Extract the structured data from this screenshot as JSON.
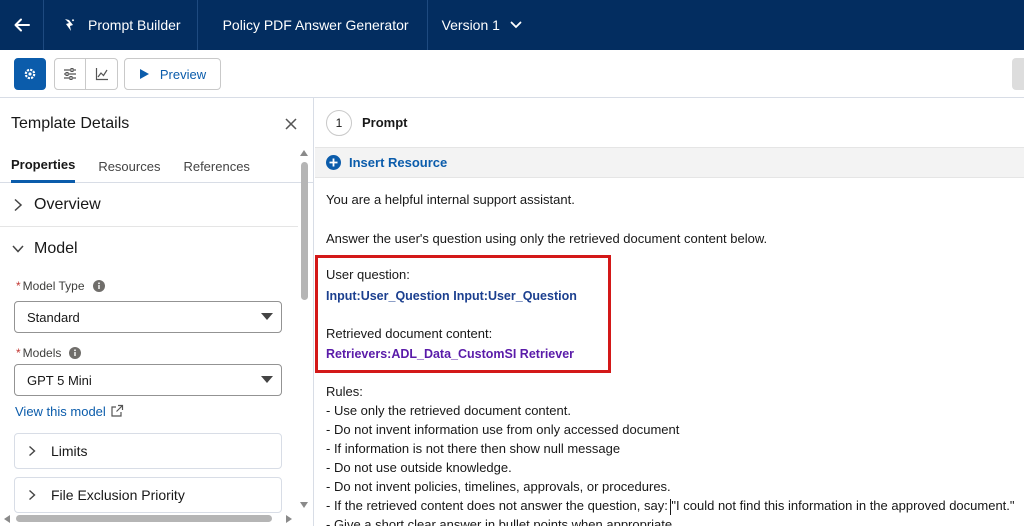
{
  "header": {
    "app_name": "Prompt Builder",
    "template_title": "Policy PDF Answer Generator",
    "version_label": "Version 1"
  },
  "toolbar": {
    "preview_label": "Preview"
  },
  "left_panel": {
    "title": "Template Details",
    "tabs": [
      {
        "label": "Properties",
        "active": true
      },
      {
        "label": "Resources",
        "active": false
      },
      {
        "label": "References",
        "active": false
      }
    ],
    "sections": {
      "overview": "Overview",
      "model": "Model",
      "limits": "Limits",
      "file_exclusion": "File Exclusion Priority"
    },
    "model_type": {
      "label": "Model Type",
      "value": "Standard"
    },
    "models": {
      "label": "Models",
      "value": "GPT 5 Mini"
    },
    "view_model_link": "View this model"
  },
  "prompt": {
    "step_number": "1",
    "title": "Prompt",
    "insert_resource": "Insert Resource",
    "lines": {
      "intro": "You are a helpful internal support assistant.",
      "instruction": "Answer the user's question using only the retrieved document content below.",
      "user_question_label": "User question:",
      "merge_user_question_1": "Input:User_Question",
      "merge_user_question_2": "Input:User_Question",
      "retrieved_label": "Retrieved document content:",
      "merge_retriever": "Retrievers:ADL_Data_CustomSI Retriever",
      "rules_label": "Rules:",
      "rule_1": "- Use only the retrieved document content.",
      "rule_2": "- Do not invent information use from only accessed document",
      "rule_3": "- If information is not there then show null message",
      "rule_4": "- Do not use outside knowledge.",
      "rule_5": "- Do not invent policies, timelines, approvals, or procedures.",
      "rule_6": "- If the retrieved content does not answer the question, say:  \"I could not find this information in the approved document.\"",
      "rule_7": "- Give a short clear answer in bullet points when appropriate."
    }
  },
  "colors": {
    "header_bg": "#032d60",
    "brand_blue": "#0b5cab",
    "highlight_red": "#d31818",
    "merge_blue": "#1b3f8f",
    "merge_purple": "#5a1ba9"
  }
}
